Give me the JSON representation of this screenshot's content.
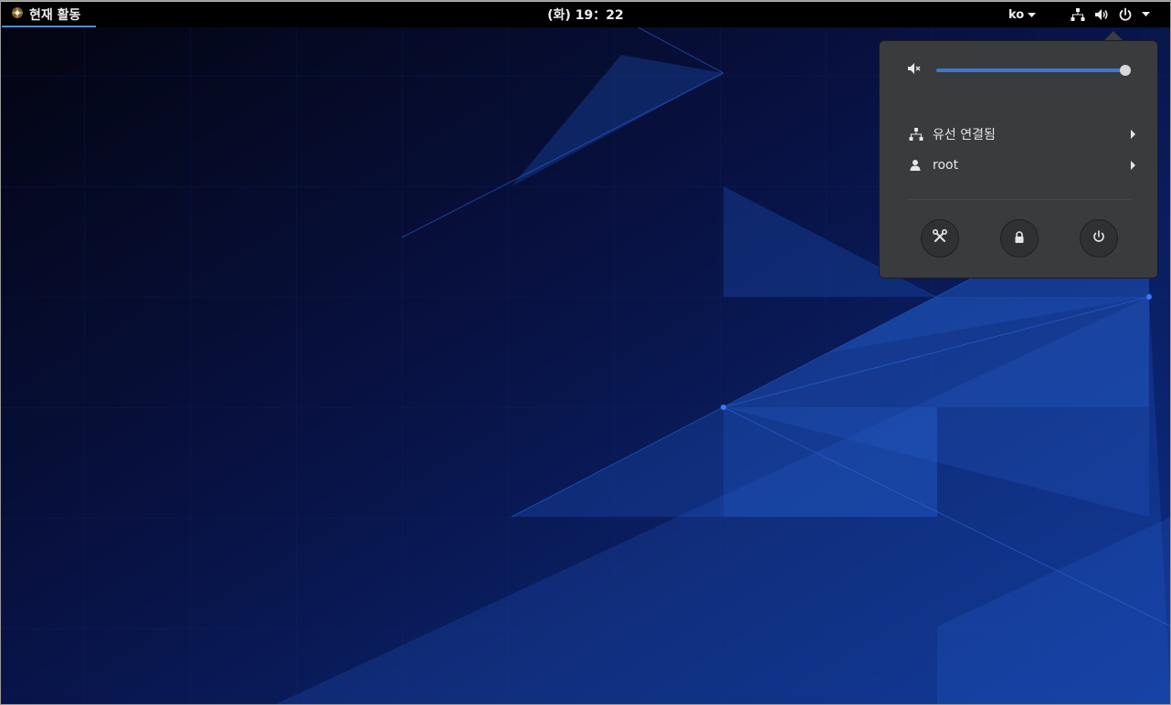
{
  "topbar": {
    "activities_label": "현재 활동",
    "clock": "(화) 19：22",
    "keyboard_layout": "ko"
  },
  "system_menu": {
    "volume": {
      "level_percent": 100
    },
    "items": [
      {
        "label": "유선 연결됨",
        "icon": "network-wired-icon"
      },
      {
        "label": "root",
        "icon": "user-icon"
      }
    ],
    "actions": [
      {
        "icon": "settings-tools-icon"
      },
      {
        "icon": "lock-icon"
      },
      {
        "icon": "power-icon"
      }
    ]
  },
  "colors": {
    "accent": "#3b78d0",
    "menu_bg": "#393b3d",
    "topbar_bg": "#000000"
  }
}
